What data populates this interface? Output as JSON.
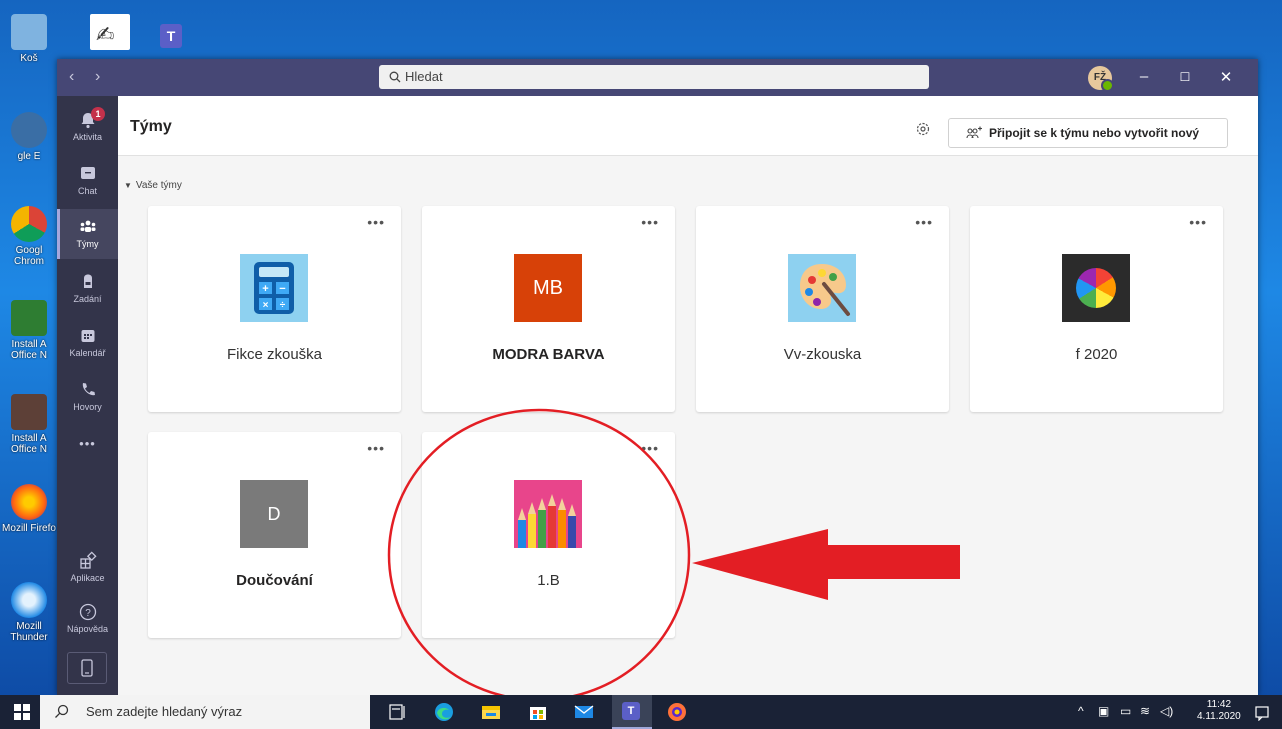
{
  "desktop": {
    "icons": [
      {
        "label": "Koš"
      },
      {
        "label": "gle E"
      },
      {
        "label": "Googl Chrom"
      },
      {
        "label": "Install A Office N"
      },
      {
        "label": "Install A Office N"
      },
      {
        "label": "Mozill Firefo"
      },
      {
        "label": "Mozill Thunder"
      }
    ]
  },
  "titlebar": {
    "search_placeholder": "Hledat",
    "avatar_initials": "FŽ"
  },
  "rail": {
    "items": [
      {
        "label": "Aktivita",
        "badge": "1"
      },
      {
        "label": "Chat"
      },
      {
        "label": "Týmy"
      },
      {
        "label": "Zadání"
      },
      {
        "label": "Kalendář"
      },
      {
        "label": "Hovory"
      },
      {
        "label": "Aplikace"
      },
      {
        "label": "Nápověda"
      }
    ],
    "more": "•••"
  },
  "header": {
    "title": "Týmy",
    "join_button": "Připojit se k týmu nebo vytvořit nový"
  },
  "section": {
    "label": "Vaše týmy"
  },
  "teams": [
    {
      "name": "Fikce zkouška",
      "tile": "calculator-icon"
    },
    {
      "name": "MODRA BARVA",
      "initials": "MB",
      "color": "#d74108"
    },
    {
      "name": "Vv-zkouska",
      "tile": "palette-icon"
    },
    {
      "name": "f 2020",
      "tile": "color-wheel-icon"
    },
    {
      "name": "Doučování",
      "initials": "D",
      "color": "#7a7a7a"
    },
    {
      "name": "1.B",
      "tile": "pencils-icon"
    }
  ],
  "card_more": "•••",
  "taskbar": {
    "search_placeholder": "Sem zadejte hledaný výraz",
    "time": "11:42",
    "date": "4.11.2020"
  }
}
